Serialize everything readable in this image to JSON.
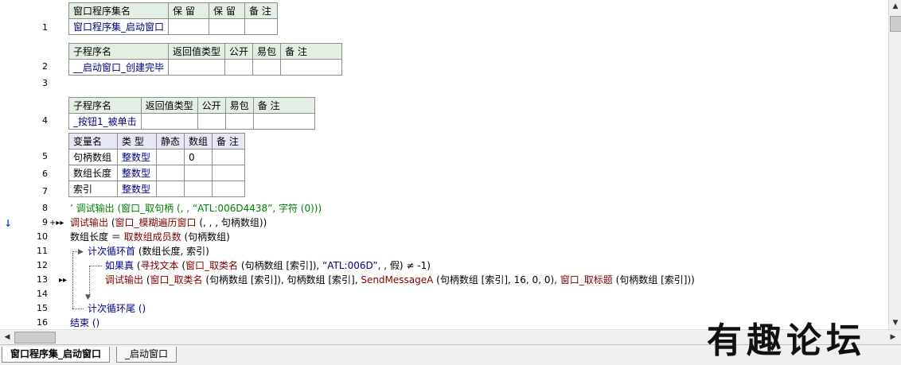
{
  "line_numbers": [
    "1",
    "2",
    "3",
    "4",
    "5",
    "6",
    "7",
    "8",
    "9",
    "10",
    "11",
    "12",
    "13",
    "14",
    "15",
    "16"
  ],
  "table_set": {
    "headers": [
      "窗口程序集名",
      "保 留",
      "保 留",
      "备 注"
    ],
    "row": [
      "窗口程序集_启动窗口",
      "",
      "",
      ""
    ]
  },
  "table_sub1": {
    "headers": [
      "子程序名",
      "返回值类型",
      "公开",
      "易包",
      "备 注"
    ],
    "row": [
      "__启动窗口_创建完毕",
      "",
      "",
      "",
      ""
    ]
  },
  "table_sub2": {
    "headers": [
      "子程序名",
      "返回值类型",
      "公开",
      "易包",
      "备 注"
    ],
    "row": [
      "_按钮1_被单击",
      "",
      "",
      "",
      ""
    ]
  },
  "table_vars": {
    "headers": [
      "变量名",
      "类 型",
      "静态",
      "数组",
      "备 注"
    ],
    "rows": [
      [
        "句柄数组",
        "整数型",
        "",
        "0",
        ""
      ],
      [
        "数组长度",
        "整数型",
        "",
        "",
        ""
      ],
      [
        "索引",
        "整数型",
        "",
        "",
        ""
      ]
    ]
  },
  "code": {
    "l8": "’ 调试输出 (窗口_取句柄 (, , “ATL:006D4438”, 字符 (0)))",
    "l9a": "调试输出",
    "l9b": " (",
    "l9c": "窗口_模糊遍历窗口",
    "l9d": " (, , , 句柄数组))",
    "l10a": "数组长度",
    "l10b": " ＝ ",
    "l10c": "取数组成员数",
    "l10d": " (句柄数组)",
    "l11a": "计次循环首",
    "l11b": " (数组长度, 索引)",
    "l12a": "如果真",
    "l12b": " (",
    "l12c": "寻找文本",
    "l12d": " (",
    "l12e": "窗口_取类名",
    "l12f": " (句柄数组 [索引]), ",
    "l12g": "“ATL:006D”",
    "l12h": ", , 假) ≠ -1)",
    "l13a": "调试输出",
    "l13b": " (",
    "l13c": "窗口_取类名",
    "l13d": " (句柄数组 [索引]), 句柄数组 [索引], ",
    "l13e": "SendMessageA",
    "l13f": " (句柄数组 [索引], 16, 0, 0), ",
    "l13g": "窗口_取标题",
    "l13h": " (句柄数组 [索引]))",
    "l15": "计次循环尾 ()",
    "l16": "结束 ()"
  },
  "markers": {
    "line9_left": "↓",
    "line9_right": "+▸▸",
    "line13_right": "▸▸"
  },
  "tabs": [
    "窗口程序集_启动窗口",
    "_启动窗口"
  ],
  "watermark": "有趣论坛",
  "icons": {
    "scroll_up": "scroll-up-arrow",
    "scroll_down": "scroll-down-arrow",
    "scroll_left": "scroll-left-arrow",
    "scroll_right": "scroll-right-arrow"
  },
  "colors": {
    "keyword": "#000080",
    "function": "#800000",
    "comment": "#008000",
    "table_header": "#e4efe4"
  }
}
